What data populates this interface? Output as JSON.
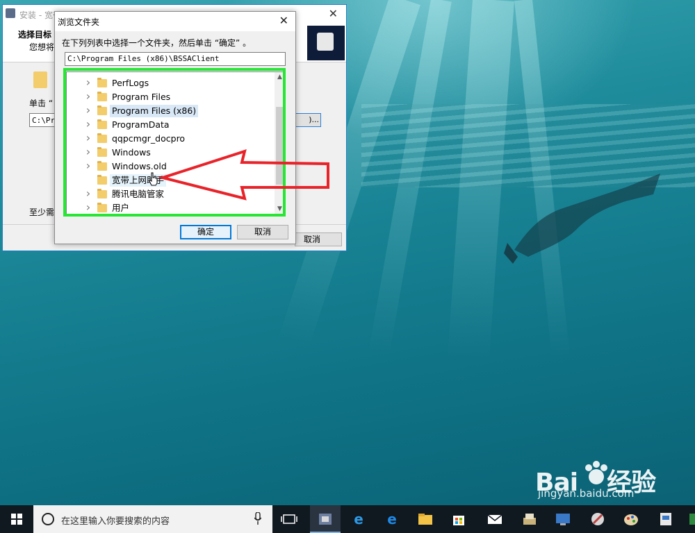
{
  "installer": {
    "title": "安装 - 宽带上网助手",
    "heading": "选择目标",
    "subtitle": "您想将",
    "click_hint": "单击 “",
    "path_value": "C:\\Pr",
    "browse_label": ")...",
    "min_space": "至少需",
    "cancel_label": "取消"
  },
  "dialog": {
    "title": "浏览文件夹",
    "instruction": "在下列列表中选择一个文件夹，然后单击 “确定” 。",
    "path": "C:\\Program Files (x86)\\BSSAClient",
    "ok_label": "确定",
    "cancel_label": "取消",
    "folders": [
      {
        "label": "PerfLogs",
        "expandable": true
      },
      {
        "label": "Program Files",
        "expandable": true
      },
      {
        "label": "Program Files (x86)",
        "expandable": true,
        "selected": true
      },
      {
        "label": "ProgramData",
        "expandable": true
      },
      {
        "label": "qqpcmgr_docpro",
        "expandable": true
      },
      {
        "label": "Windows",
        "expandable": true
      },
      {
        "label": "Windows.old",
        "expandable": true
      },
      {
        "label": "宽带上网助手",
        "expandable": false,
        "hover": true
      },
      {
        "label": "腾讯电脑管家",
        "expandable": true
      },
      {
        "label": "用户",
        "expandable": true
      }
    ]
  },
  "taskbar": {
    "search_placeholder": "在这里输入你要搜索的内容",
    "icons": [
      "task-view-icon",
      "installer-app-icon",
      "internet-explorer-icon",
      "edge-icon",
      "file-explorer-icon",
      "store-icon",
      "mail-icon",
      "app-icon-1",
      "app-icon-2",
      "app-icon-3",
      "app-icon-4",
      "app-icon-5",
      "app-icon-6"
    ]
  },
  "watermark": {
    "brand_left": "Bai",
    "brand_right": "经验",
    "url": "jingyan.baidu.com"
  },
  "colors": {
    "highlight_box": "#27e634",
    "annotation_arrow": "#e8232a",
    "selection": "#d9e8f7",
    "taskbar": "#101820"
  }
}
